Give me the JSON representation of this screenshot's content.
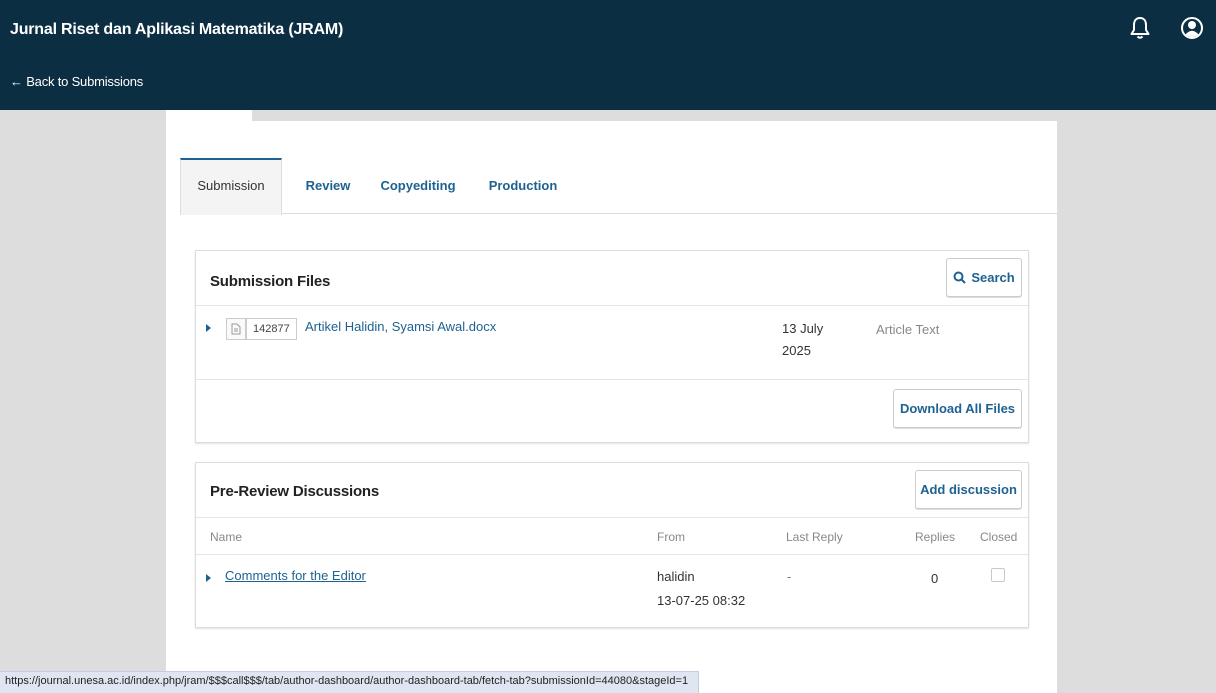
{
  "header": {
    "app_title": "Jurnal Riset dan Aplikasi Matematika (JRAM)",
    "back_link": "← Back to Submissions",
    "icons": [
      "bell-icon",
      "user-icon"
    ]
  },
  "tabs": [
    {
      "label": "Submission",
      "active": true
    },
    {
      "label": "Review",
      "active": false
    },
    {
      "label": "Copyediting",
      "active": false
    },
    {
      "label": "Production",
      "active": false
    }
  ],
  "submission_files": {
    "title": "Submission Files",
    "search_label": "Search",
    "files": [
      {
        "id": "142877",
        "name": "Artikel Halidin, Syamsi Awal.docx",
        "date_line1": "13 July",
        "date_line2": "2025",
        "type": "Article Text"
      }
    ],
    "download_all_label": "Download All Files"
  },
  "discussions": {
    "title": "Pre-Review Discussions",
    "add_label": "Add discussion",
    "columns": [
      "Name",
      "From",
      "Last Reply",
      "Replies",
      "Closed"
    ],
    "rows": [
      {
        "name": "Comments for the Editor",
        "from_user": "halidin",
        "from_date": "13-07-25 08:32",
        "last_reply": "-",
        "replies": "0",
        "closed": false
      }
    ]
  },
  "status_bar": {
    "url": "https://journal.unesa.ac.id/index.php/jram/$$$call$$$/tab/author-dashboard/author-dashboard-tab/fetch-tab?submissionId=44080&stageId=1"
  },
  "colors": {
    "header_bg": "#0c2e43",
    "link": "#1e6292",
    "page_bg": "#dddddd"
  }
}
